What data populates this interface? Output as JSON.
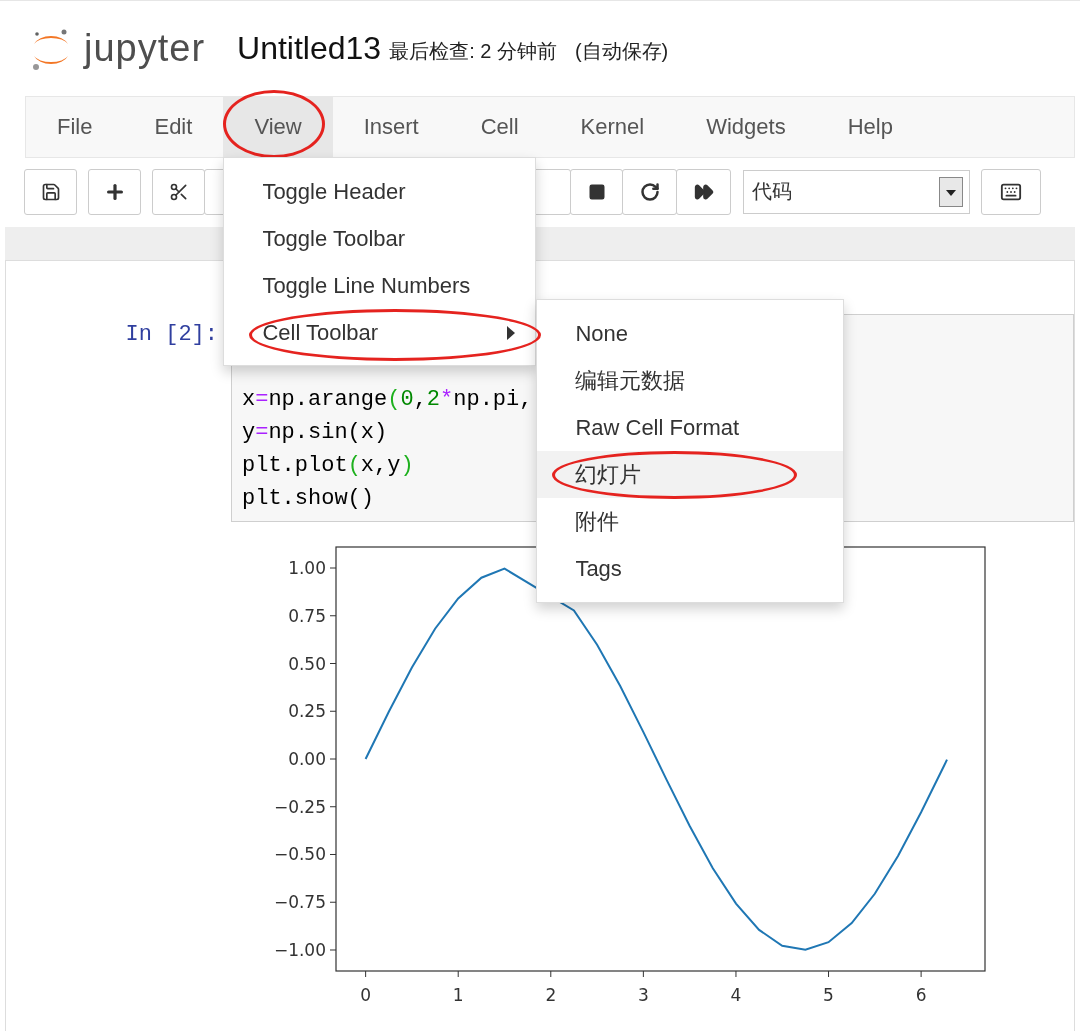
{
  "header": {
    "brand": "jupyter",
    "title": "Untitled13",
    "checkpoint": "最后检查: 2 分钟前",
    "autosave": "(自动保存)"
  },
  "menubar": [
    {
      "label": "File",
      "selected": false,
      "circled": false
    },
    {
      "label": "Edit",
      "selected": false,
      "circled": false
    },
    {
      "label": "View",
      "selected": true,
      "circled": true
    },
    {
      "label": "Insert",
      "selected": false,
      "circled": false
    },
    {
      "label": "Cell",
      "selected": false,
      "circled": false
    },
    {
      "label": "Kernel",
      "selected": false,
      "circled": false
    },
    {
      "label": "Widgets",
      "selected": false,
      "circled": false
    },
    {
      "label": "Help",
      "selected": false,
      "circled": false
    }
  ],
  "view_menu": [
    {
      "label": "Toggle Header",
      "has_submenu": false,
      "circled": false
    },
    {
      "label": "Toggle Toolbar",
      "has_submenu": false,
      "circled": false
    },
    {
      "label": "Toggle Line Numbers",
      "has_submenu": false,
      "circled": false
    },
    {
      "label": "Cell Toolbar",
      "has_submenu": true,
      "circled": true
    }
  ],
  "cell_toolbar_menu": [
    {
      "label": "None",
      "selected": false,
      "circled": false
    },
    {
      "label": "编辑元数据",
      "selected": false,
      "circled": false
    },
    {
      "label": "Raw Cell Format",
      "selected": false,
      "circled": false
    },
    {
      "label": "幻灯片",
      "selected": true,
      "circled": true
    },
    {
      "label": "附件",
      "selected": false,
      "circled": false
    },
    {
      "label": "Tags",
      "selected": false,
      "circled": false
    }
  ],
  "toolbar": {
    "cell_type": "代码"
  },
  "cell": {
    "prompt": "In [2]:",
    "code_lines": [
      [
        {
          "kind": "plain",
          "text": "x"
        },
        {
          "kind": "operator",
          "text": "="
        },
        {
          "kind": "plain",
          "text": "np.arange"
        },
        {
          "kind": "bracket",
          "text": "("
        },
        {
          "kind": "number",
          "text": "0"
        },
        {
          "kind": "plain",
          "text": ","
        },
        {
          "kind": "number",
          "text": "2"
        },
        {
          "kind": "operator",
          "text": "*"
        },
        {
          "kind": "plain",
          "text": "np.pi,"
        }
      ],
      [
        {
          "kind": "plain",
          "text": "y"
        },
        {
          "kind": "operator",
          "text": "="
        },
        {
          "kind": "plain",
          "text": "np.sin(x)"
        }
      ],
      [
        {
          "kind": "plain",
          "text": "plt.plot"
        },
        {
          "kind": "bracket",
          "text": "("
        },
        {
          "kind": "plain",
          "text": "x,y"
        },
        {
          "kind": "bracket",
          "text": ")"
        }
      ],
      [
        {
          "kind": "plain",
          "text": "plt.show()"
        }
      ]
    ],
    "output": {
      "chart_data": {
        "type": "line",
        "x": [
          0,
          0.25,
          0.5,
          0.75,
          1,
          1.25,
          1.5,
          2.25,
          2.5,
          2.75,
          3,
          3.25,
          3.5,
          3.75,
          4,
          4.25,
          4.5,
          4.75,
          5,
          5.25,
          5.5,
          5.75,
          6,
          6.25,
          6.28
        ],
        "series": [
          {
            "color": "#1f77b4",
            "values": [
              0,
              0.247,
              0.479,
              0.682,
              0.841,
              0.949,
              0.997,
              0.778,
              0.598,
              0.382,
              0.141,
              -0.108,
              -0.351,
              -0.572,
              -0.757,
              -0.895,
              -0.978,
              -0.999,
              -0.959,
              -0.859,
              -0.706,
              -0.508,
              -0.279,
              -0.033,
              -0.003
            ]
          }
        ],
        "xlim": [
          -0.32,
          6.69
        ],
        "ylim": [
          -1.11,
          1.11
        ],
        "xticks": [
          0,
          1,
          2,
          3,
          4,
          5,
          6
        ],
        "yticks": [
          {
            "value": 1,
            "label": "1.00"
          },
          {
            "value": 0.75,
            "label": "0.75"
          },
          {
            "value": 0.5,
            "label": "0.50"
          },
          {
            "value": 0.25,
            "label": "0.25"
          },
          {
            "value": 0,
            "label": "0.00"
          },
          {
            "value": -0.25,
            "label": "−0.25"
          },
          {
            "value": -0.5,
            "label": "−0.50"
          },
          {
            "value": -0.75,
            "label": "−0.75"
          },
          {
            "value": -1,
            "label": "−1.00"
          }
        ]
      }
    }
  }
}
